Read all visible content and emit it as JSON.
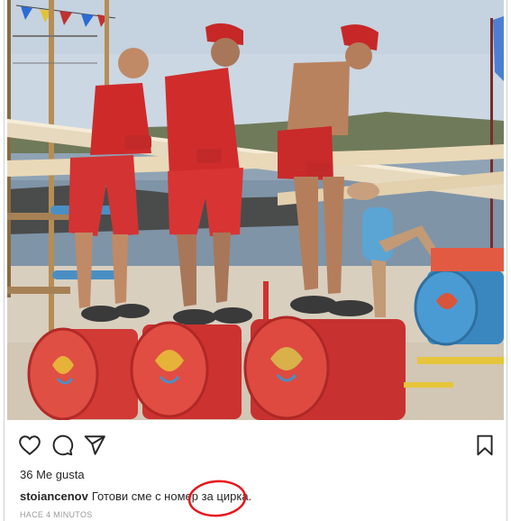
{
  "post": {
    "likes": "36 Me gusta",
    "caption_user": "stoiancenov",
    "caption_text": "Готови сме с номер за цирка.",
    "timestamp": "HACE 4 MINUTOS"
  },
  "icons": {
    "like": "heart-icon",
    "comment": "comment-bubble-icon",
    "share": "paper-plane-icon",
    "save": "bookmark-icon"
  },
  "colors": {
    "annotation": "#e8141c",
    "shirt_red": "#d62b2b",
    "sky": "#c9d6e2",
    "sea": "#7f95a8",
    "sand": "#d8cfc0"
  }
}
